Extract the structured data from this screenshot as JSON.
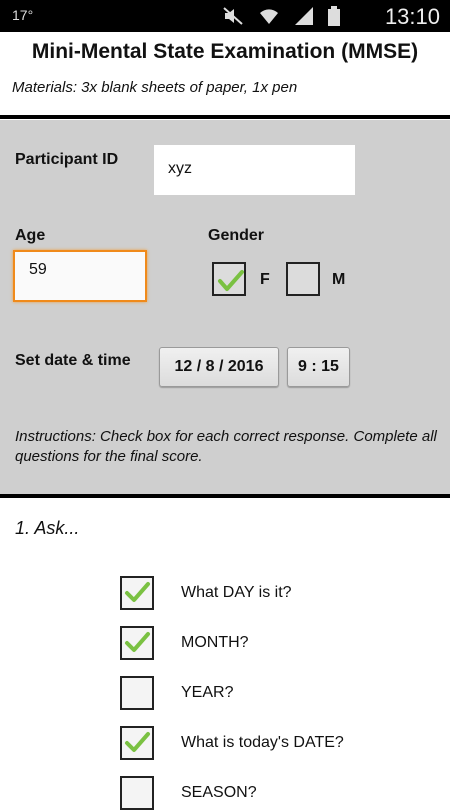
{
  "status_bar": {
    "temperature": "17°",
    "time": "13:10",
    "icons": [
      "mute-icon",
      "wifi-icon",
      "signal-icon",
      "battery-icon"
    ]
  },
  "header": {
    "title": "Mini-Mental State Examination (MMSE)",
    "materials": "Materials: 3x blank sheets of paper, 1x pen"
  },
  "form": {
    "participant_id_label": "Participant ID",
    "participant_id_value": "xyz",
    "age_label": "Age",
    "age_value": "59",
    "gender_label": "Gender",
    "gender_options": [
      {
        "label": "F",
        "checked": true
      },
      {
        "label": "M",
        "checked": false
      }
    ],
    "datetime_label": "Set date & time",
    "date_value": "12 / 8 / 2016",
    "time_value": "9 : 15",
    "instructions": "Instructions: Check box for each correct response. Complete all questions for the final score."
  },
  "questions_section": {
    "title": "1. Ask...",
    "items": [
      {
        "label": "What DAY is it?",
        "checked": true
      },
      {
        "label": "MONTH?",
        "checked": true
      },
      {
        "label": "YEAR?",
        "checked": false
      },
      {
        "label": "What is today's DATE?",
        "checked": true
      },
      {
        "label": "SEASON?",
        "checked": false
      }
    ]
  },
  "colors": {
    "panel_bg": "#cfcfcf",
    "focus_border": "#f08a1a",
    "check_green": "#7ac142"
  }
}
